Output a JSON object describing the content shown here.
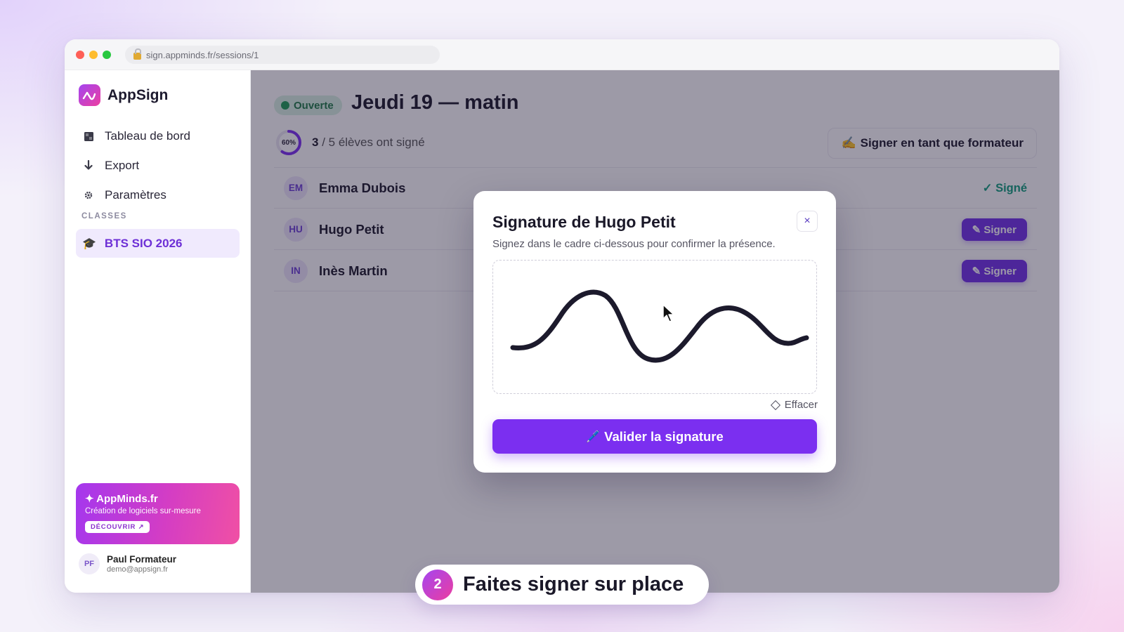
{
  "browser": {
    "url": "sign.appminds.fr/sessions/1"
  },
  "sidebar": {
    "brand": "AppSign",
    "nav": [
      {
        "label": "Tableau de bord",
        "icon": "grid-icon"
      },
      {
        "label": "Export",
        "icon": "download-icon"
      },
      {
        "label": "Paramètres",
        "icon": "gear-icon"
      }
    ],
    "section_label": "CLASSES",
    "classes": [
      {
        "label": "BTS SIO 2026",
        "icon": "graduation-cap-icon"
      }
    ],
    "promo": {
      "title": "✦ AppMinds.fr",
      "subtitle": "Création de logiciels sur-mesure",
      "button": "DÉCOUVRIR ↗"
    },
    "user": {
      "initials": "PF",
      "name": "Paul Formateur",
      "email": "demo@appsign.fr"
    }
  },
  "session": {
    "status": "Ouverte",
    "title": "Jeudi 19 — matin",
    "progress_percent": 60,
    "progress_label": "60%",
    "signed_count": "3",
    "total_text": " / 5 élèves ont signé",
    "trainer_button": "Signer en tant que formateur",
    "trainer_icon": "✍️"
  },
  "students": [
    {
      "initials": "EM",
      "name": "Emma Dubois",
      "status": "signed",
      "status_label": "✓ Signé"
    },
    {
      "initials": "HU",
      "name": "Hugo Petit",
      "status": "pending",
      "action_label": "✎ Signer"
    },
    {
      "initials": "IN",
      "name": "Inès Martin",
      "status": "pending",
      "action_label": "✎ Signer"
    }
  ],
  "modal": {
    "title": "Signature de Hugo Petit",
    "subtitle": "Signez dans le cadre ci-dessous pour confirmer la présence.",
    "close": "×",
    "clear_label": "Effacer",
    "validate_label": "Valider la signature",
    "validate_icon": "🖊️"
  },
  "caption": {
    "step": "2",
    "text": "Faites signer sur place"
  },
  "colors": {
    "accent": "#7b2ff0",
    "success": "#1e9c55",
    "signed": "#0f9e7b",
    "brand_gradient": [
      "#a445f0",
      "#ec3ea0"
    ]
  }
}
